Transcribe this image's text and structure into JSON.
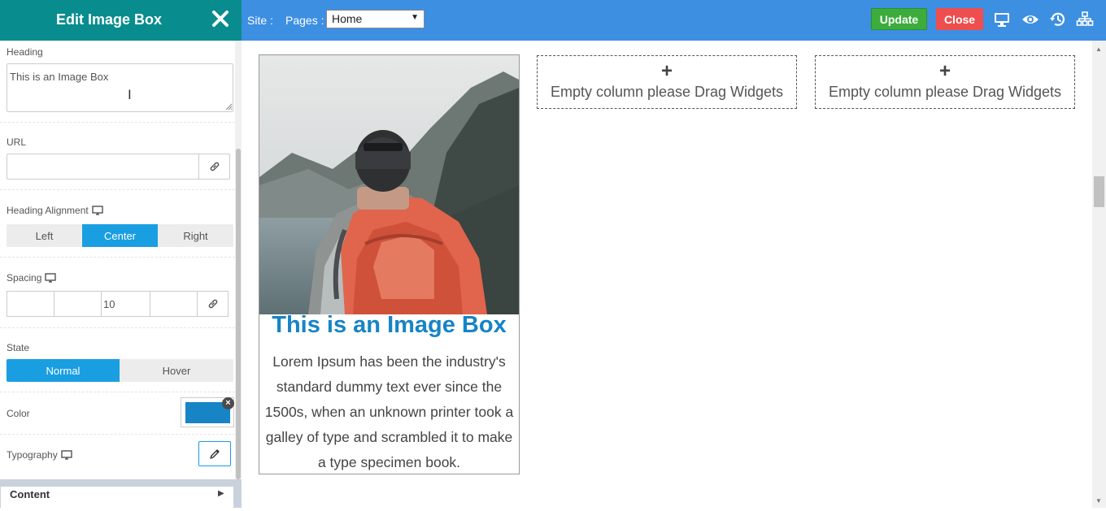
{
  "panel": {
    "title": "Edit Image Box",
    "heading": {
      "label": "Heading",
      "value": "This is an Image Box"
    },
    "url": {
      "label": "URL",
      "value": ""
    },
    "heading_alignment": {
      "label": "Heading Alignment",
      "options": [
        "Left",
        "Center",
        "Right"
      ],
      "selected": "Center"
    },
    "spacing": {
      "label": "Spacing",
      "values": [
        "",
        "",
        "10",
        ""
      ]
    },
    "state": {
      "label": "State",
      "options": [
        "Normal",
        "Hover"
      ],
      "selected": "Normal"
    },
    "color": {
      "label": "Color",
      "value": "#1784c6"
    },
    "typography": {
      "label": "Typography"
    },
    "content_section": {
      "label": "Content"
    }
  },
  "topbar": {
    "site_label": "Site :",
    "pages_label": "Pages :",
    "pages_selected": "Home",
    "update_label": "Update",
    "close_label": "Close",
    "icons": [
      "desktop-icon",
      "eye-icon",
      "history-icon",
      "sitemap-icon"
    ]
  },
  "canvas": {
    "image_box": {
      "title": "This is an Image Box",
      "description": "Lorem Ipsum has been the industry's standard dummy text ever since the 1500s, when an unknown printer took a galley of type and scrambled it to make a type specimen book.",
      "title_color": "#1784c6"
    },
    "empty_columns": [
      {
        "plus": "+",
        "message": "Empty column please Drag Widgets"
      },
      {
        "plus": "+",
        "message": "Empty column please Drag Widgets"
      }
    ]
  },
  "colors": {
    "panel_header": "#098c8e",
    "topbar": "#3d8fe2",
    "update_button": "#3cad3c",
    "close_button": "#ee4e4e",
    "active_toggle": "#1a9ee2"
  }
}
